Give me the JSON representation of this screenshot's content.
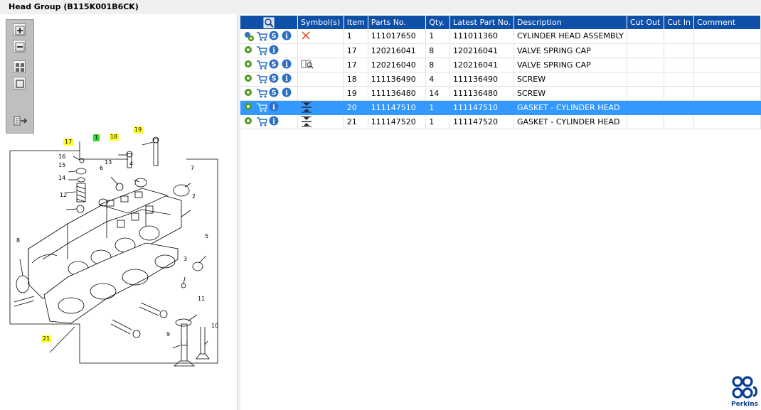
{
  "window": {
    "title": "Head Group (B115K001B6CK)"
  },
  "toolbar": {
    "buttons": [
      {
        "name": "zoom-in-button",
        "icon": "zoom-in-icon"
      },
      {
        "name": "zoom-out-button",
        "icon": "zoom-out-icon"
      },
      {
        "name": "fit-all-button",
        "icon": "fit-all-icon"
      },
      {
        "name": "fit-window-button",
        "icon": "fit-window-icon"
      },
      {
        "name": "export-button",
        "icon": "export-icon"
      }
    ]
  },
  "diagram": {
    "callouts": [
      "17",
      "1",
      "18",
      "19",
      "16",
      "15",
      "14",
      "13",
      "6",
      "4",
      "7",
      "12",
      "2",
      "8",
      "5",
      "3",
      "11",
      "9",
      "10",
      "21"
    ]
  },
  "table": {
    "header_icon": "search-icon",
    "columns": [
      "Symbol(s)",
      "Item",
      "Parts No.",
      "Qty.",
      "Latest Part No.",
      "Description",
      "Cut Out",
      "Cut In",
      "Comment"
    ],
    "rows": [
      {
        "item": "1",
        "part_no": "111017650",
        "qty": "1",
        "latest": "111011360",
        "desc": "CYLINDER HEAD ASSEMBLY",
        "cut_out": "",
        "cut_in": "",
        "comment": "",
        "symbol": "cross-icon",
        "gear": "gears-icon",
        "selected": false
      },
      {
        "item": "17",
        "part_no": "120216041",
        "qty": "8",
        "latest": "120216041",
        "desc": "VALVE SPRING CAP",
        "cut_out": "",
        "cut_in": "",
        "comment": "",
        "symbol": "",
        "gear": "gear-icon",
        "selected": false
      },
      {
        "item": "17",
        "part_no": "120216040",
        "qty": "8",
        "latest": "120216041",
        "desc": "VALVE SPRING CAP",
        "cut_out": "",
        "cut_in": "",
        "comment": "",
        "symbol": "book-search-icon",
        "gear": "gear-icon",
        "selected": false
      },
      {
        "item": "18",
        "part_no": "111136490",
        "qty": "4",
        "latest": "111136490",
        "desc": "SCREW",
        "cut_out": "",
        "cut_in": "",
        "comment": "",
        "symbol": "",
        "gear": "gear-icon",
        "selected": false
      },
      {
        "item": "19",
        "part_no": "111136480",
        "qty": "14",
        "latest": "111136480",
        "desc": "SCREW",
        "cut_out": "",
        "cut_in": "",
        "comment": "",
        "symbol": "",
        "gear": "gear-icon",
        "selected": false
      },
      {
        "item": "20",
        "part_no": "111147510",
        "qty": "1",
        "latest": "111147510",
        "desc": "GASKET - CYLINDER HEAD",
        "cut_out": "",
        "cut_in": "",
        "comment": "",
        "symbol": "compress-icon",
        "gear": "gear-icon",
        "selected": true
      },
      {
        "item": "21",
        "part_no": "111147520",
        "qty": "1",
        "latest": "111147520",
        "desc": "GASKET - CYLINDER HEAD",
        "cut_out": "",
        "cut_in": "",
        "comment": "",
        "symbol": "compress-icon",
        "gear": "gear-icon",
        "selected": false
      }
    ]
  },
  "brand": {
    "name": "Perkins",
    "color": "#0b3d91"
  },
  "colors": {
    "header": "#0e4fa8",
    "selection": "#3399ff",
    "highlight": "#ffff33",
    "accent": "#33dd33"
  }
}
